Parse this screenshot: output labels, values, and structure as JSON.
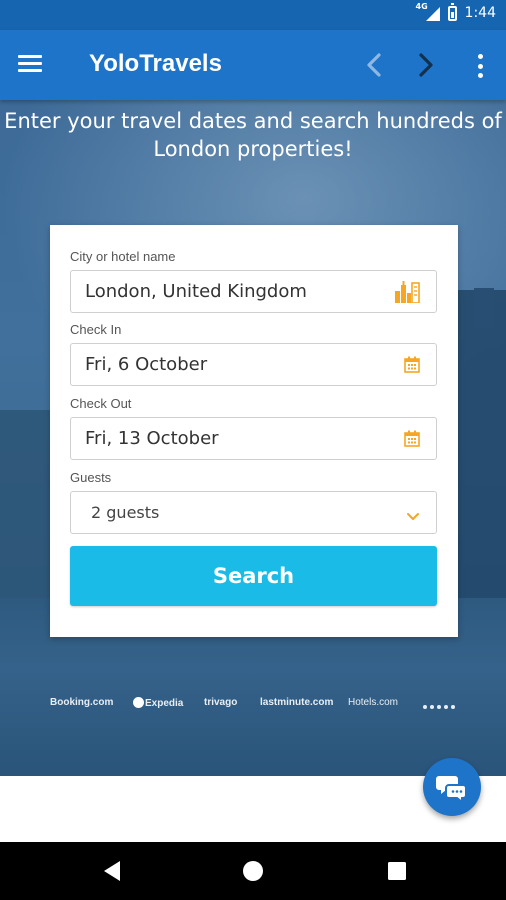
{
  "status_bar": {
    "network": "4G",
    "time": "1:44"
  },
  "app_bar": {
    "title": "YoloTravels",
    "icons": {
      "menu": "hamburger-menu-icon",
      "back": "chevron-left-icon",
      "forward": "chevron-right-icon",
      "overflow": "more-vertical-icon"
    }
  },
  "hero": {
    "headline": "Enter your travel dates and search hundreds of London properties!"
  },
  "form": {
    "city": {
      "label": "City or hotel name",
      "value": "London, United Kingdom",
      "icon": "city-buildings-icon"
    },
    "check_in": {
      "label": "Check In",
      "value": "Fri, 6 October",
      "icon": "calendar-icon"
    },
    "check_out": {
      "label": "Check Out",
      "value": "Fri, 13 October",
      "icon": "calendar-icon"
    },
    "guests": {
      "label": "Guests",
      "value": "2 guests",
      "icon": "chevron-down-icon"
    },
    "search_button": "Search"
  },
  "partners": {
    "booking": "Booking.com",
    "expedia": "Expedia",
    "trivago": "trivago",
    "lastminute": "lastminute.com",
    "hotels": "Hotels.com"
  },
  "chat": {
    "icon": "chat-bubbles-icon"
  },
  "colors": {
    "app_bar": "#1e74c9",
    "status_bar": "#1565b0",
    "search_button": "#1bbbe8",
    "field_icon": "#f5a623"
  }
}
